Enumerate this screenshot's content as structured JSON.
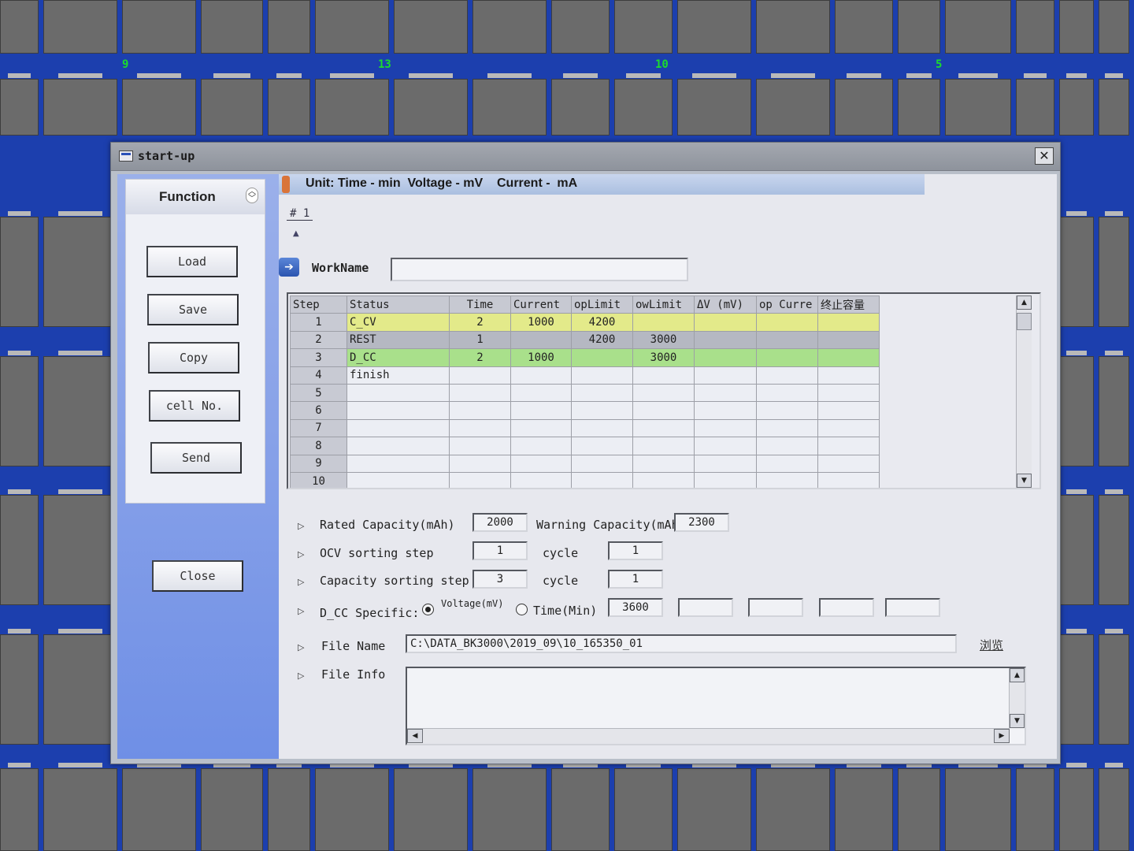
{
  "background": {
    "cell_labels": [
      "9",
      "13",
      "10",
      "5"
    ],
    "label_color": "#1bdc2c"
  },
  "window": {
    "title": "start-up",
    "close_glyph": "✕"
  },
  "function_panel": {
    "title": "Function",
    "buttons": [
      {
        "label": "Load"
      },
      {
        "label": "Save"
      },
      {
        "label": "Copy"
      },
      {
        "label": "cell No."
      },
      {
        "label": "Send"
      }
    ],
    "close_label": "Close"
  },
  "unit_bar": {
    "text": "Unit: Time - min  Voltage - mV    Current -  mA"
  },
  "step_tab": "# 1",
  "workname": {
    "label": "WorkName",
    "value": ""
  },
  "step_table": {
    "columns": [
      "Step",
      "Status",
      "Time",
      "Current",
      "opLimit",
      "owLimit",
      "ΔV (mV)",
      "op Curre",
      "终止容量"
    ],
    "rows": [
      {
        "step": "1",
        "status": "C_CV",
        "time": "2",
        "current": "1000",
        "oplimit": "4200",
        "owlimit": "",
        "dv": "",
        "opcurrent": "",
        "capacity": ""
      },
      {
        "step": "2",
        "status": "REST",
        "time": "1",
        "current": "",
        "oplimit": "4200",
        "owlimit": "3000",
        "dv": "",
        "opcurrent": "",
        "capacity": ""
      },
      {
        "step": "3",
        "status": "D_CC",
        "time": "2",
        "current": "1000",
        "oplimit": "",
        "owlimit": "3000",
        "dv": "",
        "opcurrent": "",
        "capacity": ""
      },
      {
        "step": "4",
        "status": "finish",
        "time": "",
        "current": "",
        "oplimit": "",
        "owlimit": "",
        "dv": "",
        "opcurrent": "",
        "capacity": ""
      },
      {
        "step": "5",
        "status": "",
        "time": "",
        "current": "",
        "oplimit": "",
        "owlimit": "",
        "dv": "",
        "opcurrent": "",
        "capacity": ""
      },
      {
        "step": "6",
        "status": "",
        "time": "",
        "current": "",
        "oplimit": "",
        "owlimit": "",
        "dv": "",
        "opcurrent": "",
        "capacity": ""
      },
      {
        "step": "7",
        "status": "",
        "time": "",
        "current": "",
        "oplimit": "",
        "owlimit": "",
        "dv": "",
        "opcurrent": "",
        "capacity": ""
      },
      {
        "step": "8",
        "status": "",
        "time": "",
        "current": "",
        "oplimit": "",
        "owlimit": "",
        "dv": "",
        "opcurrent": "",
        "capacity": ""
      },
      {
        "step": "9",
        "status": "",
        "time": "",
        "current": "",
        "oplimit": "",
        "owlimit": "",
        "dv": "",
        "opcurrent": "",
        "capacity": ""
      },
      {
        "step": "10",
        "status": "",
        "time": "",
        "current": "",
        "oplimit": "",
        "owlimit": "",
        "dv": "",
        "opcurrent": "",
        "capacity": ""
      }
    ],
    "row_colors": {
      "C_CV": "#e3ea8a",
      "REST": "#b5b8c2",
      "D_CC": "#a9e08b"
    }
  },
  "form": {
    "rated_capacity": {
      "label": "Rated Capacity(mAh)",
      "value": "2000"
    },
    "warning_capacity": {
      "label": "Warning Capacity(mAh)",
      "value": "2300"
    },
    "ocv_sorting": {
      "label": "OCV sorting step",
      "value": "1",
      "cycle_label": "cycle",
      "cycle_value": "1"
    },
    "capacity_sorting": {
      "label": "Capacity sorting step",
      "value": "3",
      "cycle_label": "cycle",
      "cycle_value": "1"
    },
    "dcc_specific": {
      "label": "D_CC Specific:",
      "voltage_label": "Voltage(mV)",
      "time_label": "Time(Min)",
      "selected": "voltage",
      "value": "3600",
      "extra_values": [
        "",
        "",
        "",
        ""
      ]
    },
    "file_name": {
      "label": "File Name",
      "value": "C:\\DATA_BK3000\\2019_09\\10_165350_01",
      "browse_label": "浏览"
    },
    "file_info": {
      "label": "File Info",
      "value": ""
    }
  }
}
